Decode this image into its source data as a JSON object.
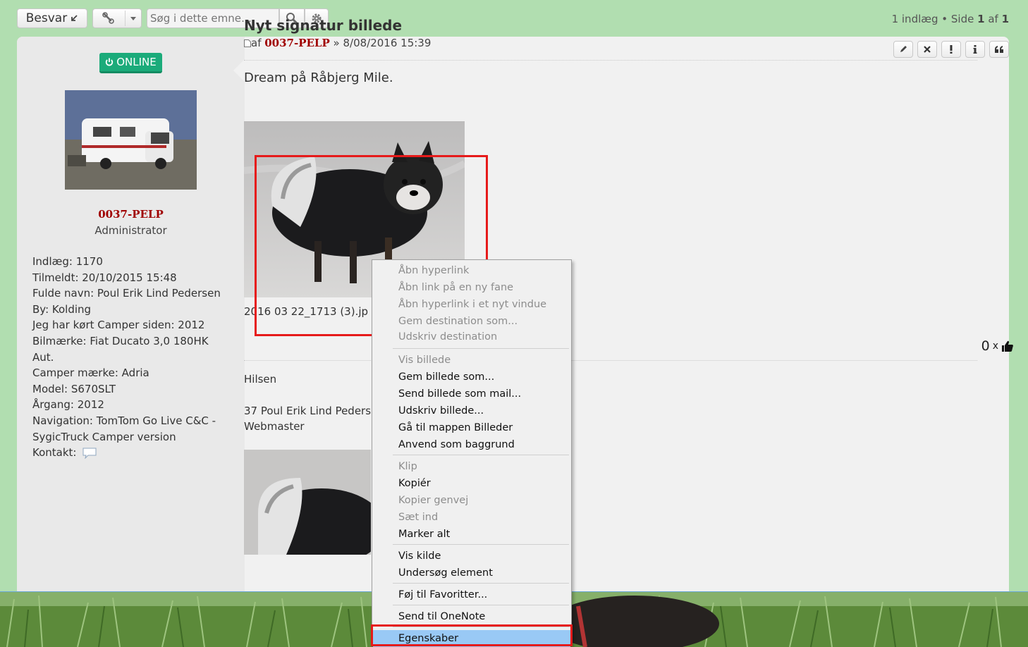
{
  "toolbar": {
    "reply_label": "Besvar",
    "search_placeholder": "Søg i dette emne…",
    "pagination": {
      "posts": "1 indlæg • Side ",
      "current": "1",
      "of": " af ",
      "total": "1"
    }
  },
  "profile": {
    "online_label": "ONLINE",
    "username": "0037-PELP",
    "rank": "Administrator",
    "fields": [
      "Indlæg: 1170",
      "Tilmeldt: 20/10/2015 15:48",
      "Fulde navn: Poul Erik Lind Pedersen",
      "By: Kolding",
      "Jeg har kørt Camper siden: 2012",
      "Bilmærke: Fiat Ducato 3,0 180HK Aut.",
      "Camper mærke: Adria",
      "Model: S670SLT",
      "Årgang: 2012",
      "Navigation: TomTom Go Live C&C -",
      "SygicTruck Camper version"
    ],
    "contact_label": "Kontakt:"
  },
  "post": {
    "title": "Nyt signatur billede",
    "meta_prefix": "af ",
    "author": "0037-PELP",
    "meta_date": " » 8/08/2016 15:39",
    "body": "Dream på Råbjerg Mile.",
    "attachment_name": "2016 03 22_1713 (3).jp",
    "like_count": "0",
    "like_x": "x",
    "sig_greeting": "Hilsen",
    "sig_line1": "37 Poul Erik Lind Peders",
    "sig_line2": "Webmaster"
  },
  "context_menu": {
    "items": [
      {
        "label": "Åbn hyperlink",
        "enabled": false
      },
      {
        "label": "Åbn link på en ny fane",
        "enabled": false
      },
      {
        "label": "Åbn hyperlink i et nyt vindue",
        "enabled": false
      },
      {
        "label": "Gem destination som...",
        "enabled": false
      },
      {
        "label": "Udskriv destination",
        "enabled": false
      },
      {
        "label": "Vis billede",
        "enabled": false
      },
      {
        "label": "Gem billede som...",
        "enabled": true
      },
      {
        "label": "Send billede som mail...",
        "enabled": true
      },
      {
        "label": "Udskriv billede...",
        "enabled": true
      },
      {
        "label": "Gå til mappen Billeder",
        "enabled": true
      },
      {
        "label": "Anvend som baggrund",
        "enabled": true
      },
      {
        "label": "Klip",
        "enabled": false
      },
      {
        "label": "Kopiér",
        "enabled": true
      },
      {
        "label": "Kopier genvej",
        "enabled": false
      },
      {
        "label": "Sæt ind",
        "enabled": false
      },
      {
        "label": "Marker alt",
        "enabled": true
      },
      {
        "label": "Vis kilde",
        "enabled": true
      },
      {
        "label": "Undersøg element",
        "enabled": true
      },
      {
        "label": "Føj til Favoritter...",
        "enabled": true
      },
      {
        "label": "Send til OneNote",
        "enabled": true
      },
      {
        "label": "Egenskaber",
        "enabled": true,
        "selected": true
      }
    ]
  },
  "colors": {
    "background": "#b1deb0",
    "author": "#a00000",
    "online_badge": "#1bab7a",
    "highlight": "#e61a1a",
    "menu_selected": "#99c9f5"
  },
  "icons": [
    "reply-arrow-icon",
    "wrench-icon",
    "caret-down-icon",
    "search-icon",
    "gear-icon",
    "power-icon",
    "post-icon",
    "edit-icon",
    "delete-icon",
    "report-icon",
    "info-icon",
    "quote-icon",
    "thumbs-up-icon",
    "contact-icon"
  ]
}
